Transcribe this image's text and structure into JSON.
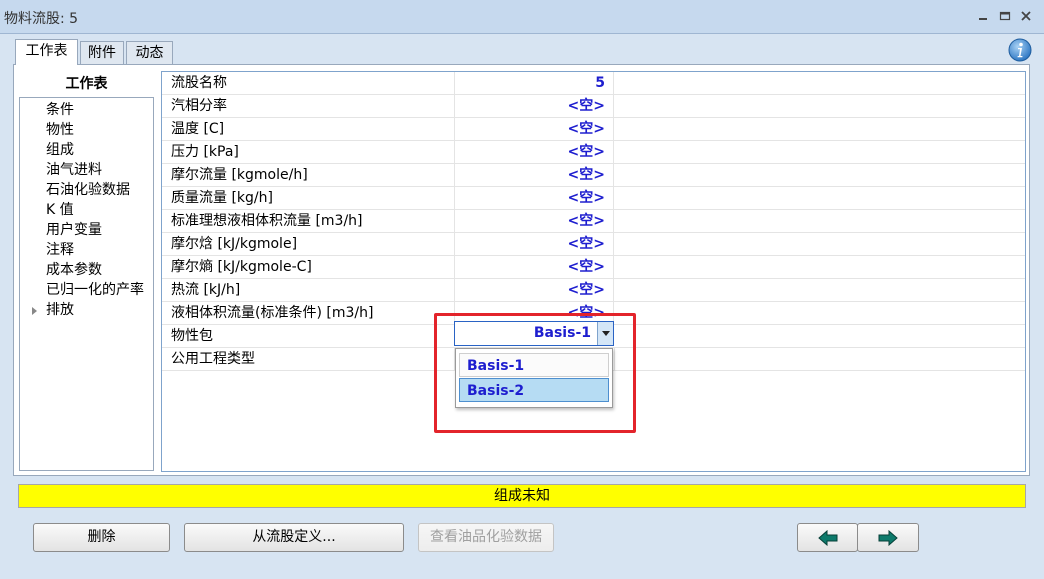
{
  "window": {
    "title": "物料流股: 5"
  },
  "tabs": [
    {
      "label": "工作表",
      "active": true
    },
    {
      "label": "附件",
      "active": false
    },
    {
      "label": "动态",
      "active": false
    }
  ],
  "nav": {
    "title": "工作表",
    "items": [
      "条件",
      "物性",
      "组成",
      "油气进料",
      "石油化验数据",
      "K 值",
      "用户变量",
      "注释",
      "成本参数",
      "已归一化的产率",
      "排放"
    ]
  },
  "grid": {
    "rows": [
      {
        "label": "流股名称",
        "value": "5"
      },
      {
        "label": "汽相分率",
        "value": "<空>"
      },
      {
        "label": "温度 [C]",
        "value": "<空>"
      },
      {
        "label": "压力 [kPa]",
        "value": "<空>"
      },
      {
        "label": "摩尔流量 [kgmole/h]",
        "value": "<空>"
      },
      {
        "label": "质量流量 [kg/h]",
        "value": "<空>"
      },
      {
        "label": "标准理想液相体积流量 [m3/h]",
        "value": "<空>"
      },
      {
        "label": "摩尔焓 [kJ/kgmole]",
        "value": "<空>"
      },
      {
        "label": "摩尔熵 [kJ/kgmole-C]",
        "value": "<空>"
      },
      {
        "label": "热流 [kJ/h]",
        "value": "<空>"
      },
      {
        "label": "液相体积流量(标准条件) [m3/h]",
        "value": "<空>"
      },
      {
        "label": "物性包",
        "value": ""
      },
      {
        "label": "公用工程类型",
        "value": ""
      }
    ]
  },
  "property_package": {
    "selected": "Basis-1",
    "options": [
      "Basis-1",
      "Basis-2"
    ],
    "highlighted": "Basis-2"
  },
  "status": {
    "text": "组成未知",
    "color": "#ffff00"
  },
  "buttons": {
    "delete": "删除",
    "define_from_stream": "从流股定义...",
    "view_assay": "查看油品化验数据"
  },
  "colors": {
    "value_text": "#1e1ecf",
    "highlight_border": "#e3242b",
    "selected_option": "#b6dcf3"
  }
}
